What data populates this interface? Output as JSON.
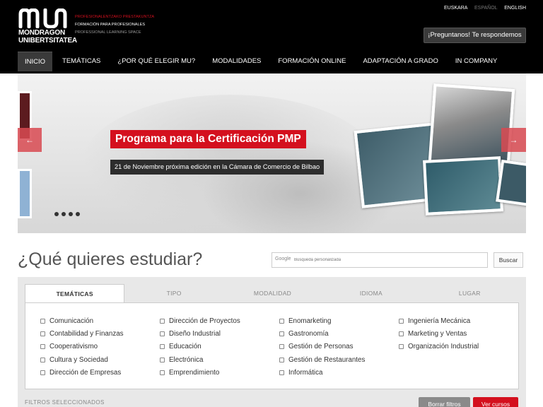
{
  "brand": {
    "name_line1": "MONDRAGON",
    "name_line2": "UNIBERTSITATEA",
    "tagline_1": "PROFESIONALENTZAKO PRESTAKUNTZA",
    "tagline_2": "FORMACIÓN PARA PROFESIONALES",
    "tagline_3": "PROFESSIONAL LEARNING SPACE",
    "accent_color": "#d4101e"
  },
  "languages": [
    "EUSKARA",
    "ESPAÑOL",
    "ENGLISH"
  ],
  "ask_button": "¡Preguntanos! Te respondemos",
  "nav": [
    "INICIO",
    "TEMÁTICAS",
    "¿POR QUÉ ELEGIR MU?",
    "MODALIDADES",
    "FORMACIÓN ONLINE",
    "ADAPTACIÓN A GRADO",
    "IN COMPANY"
  ],
  "hero": {
    "headline": "Programa para la Certificación PMP",
    "subline": "21 de Noviembre próxima edición en la Cámara de Comercio de Bilbao",
    "prev_icon": "arrow-left-icon",
    "next_icon": "arrow-right-icon"
  },
  "study": {
    "title": "¿Qué quieres estudiar?",
    "search_brand": "Google",
    "search_placeholder": "Búsqueda personalizada",
    "search_button": "Buscar"
  },
  "tabs": [
    "TEMÁTICAS",
    "TIPO",
    "MODALIDAD",
    "IDIOMA",
    "LUGAR"
  ],
  "topics": [
    [
      "Comunicación",
      "Contabilidad y Finanzas",
      "Cooperativismo",
      "Cultura y Sociedad",
      "Dirección de Empresas"
    ],
    [
      "Dirección de Proyectos",
      "Diseño Industrial",
      "Educación",
      "Electrónica",
      "Emprendimiento"
    ],
    [
      "Enomarketing",
      "Gastronomía",
      "Gestión de Personas",
      "Gestión de Restaurantes",
      "Informática"
    ],
    [
      "Ingeniería Mecánica",
      "Marketing y Ventas",
      "Organización Industrial"
    ]
  ],
  "filters": {
    "label": "FILTROS SELECCIONADOS",
    "clear_button": "Borrar filtros",
    "view_button": "Ver cursos"
  }
}
